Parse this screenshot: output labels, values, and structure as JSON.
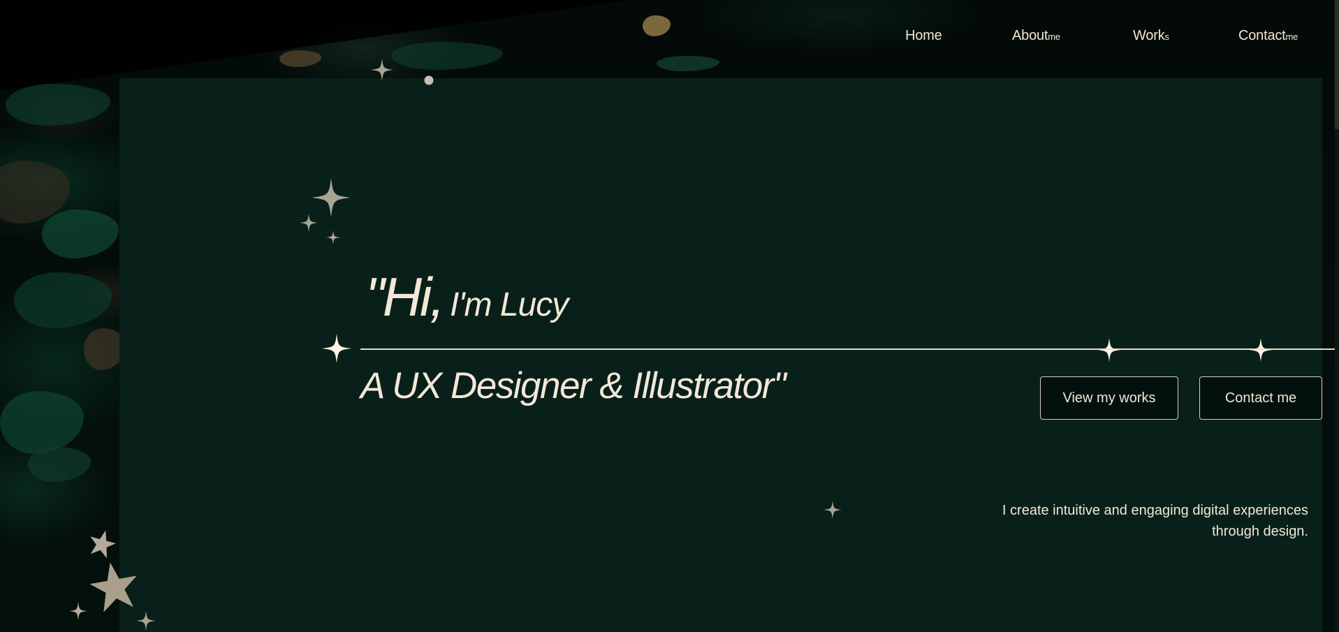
{
  "nav": {
    "home": {
      "label": "Home"
    },
    "about": {
      "label": "About",
      "suffix": "me"
    },
    "works": {
      "label": "Work",
      "suffix": "s"
    },
    "contact": {
      "label": "Contact",
      "suffix": "me"
    }
  },
  "hero": {
    "greeting_big": "\"Hi,",
    "greeting_name": "I'm Lucy",
    "subtitle": "A UX Designer & Illustrator\"",
    "tagline_line1": "I create intuitive and engaging digital experiences",
    "tagline_line2": "through design."
  },
  "buttons": {
    "view_works": "View my works",
    "contact_me": "Contact me"
  },
  "colors": {
    "panel": "#082019",
    "text": "#f3e7d8",
    "star_light": "#fff3e3",
    "star_muted": "#a8a393"
  }
}
